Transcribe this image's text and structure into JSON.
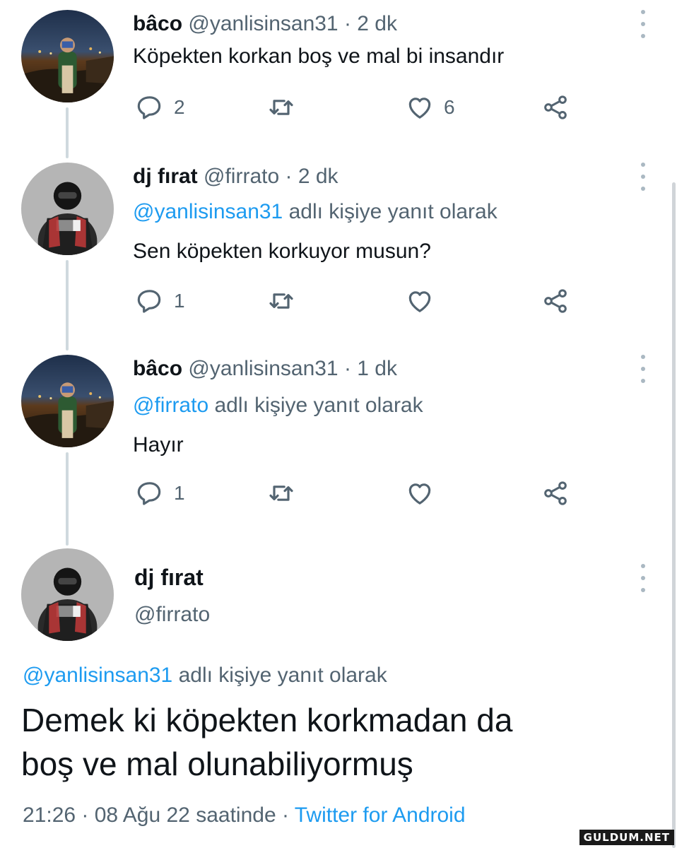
{
  "colors": {
    "link": "#1d9bf0",
    "secondary_text": "#536471",
    "primary_text": "#0f1419",
    "thread_line": "#cfd9de"
  },
  "tweets": [
    {
      "display_name": "bâco",
      "handle": "@yanlisinsan31",
      "time": " · 2 dk",
      "reply_to": "",
      "reply_suffix": "",
      "text": "Köpekten korkan boş ve mal bi insandır",
      "reply_count": "2",
      "retweet_count": "",
      "like_count": "6"
    },
    {
      "display_name": "dj fırat",
      "handle": "@firrato",
      "time": " · 2 dk",
      "reply_to": "@yanlisinsan31",
      "reply_suffix": " adlı kişiye yanıt olarak",
      "text": "Sen köpekten korkuyor musun?",
      "reply_count": "1",
      "retweet_count": "",
      "like_count": ""
    },
    {
      "display_name": "bâco",
      "handle": "@yanlisinsan31",
      "time": " · 1 dk",
      "reply_to": "@firrato",
      "reply_suffix": " adlı kişiye yanıt olarak",
      "text": "Hayır",
      "reply_count": "1",
      "retweet_count": "",
      "like_count": ""
    }
  ],
  "main_tweet": {
    "display_name": "dj fırat",
    "handle": "@firrato",
    "reply_to": "@yanlisinsan31",
    "reply_suffix": " adlı kişiye yanıt olarak",
    "text_line1": "Demek ki köpekten korkmadan da",
    "text_line2": "boş ve mal olunabiliyormuş",
    "timestamp": "21:26 · 08 Ağu 22 saatinde · ",
    "source": "Twitter for Android"
  },
  "watermark": "GULDUM.NET",
  "icons": {
    "reply": "reply-icon",
    "retweet": "retweet-icon",
    "like": "heart-icon",
    "share": "share-icon",
    "more": "more-vertical-icon"
  }
}
